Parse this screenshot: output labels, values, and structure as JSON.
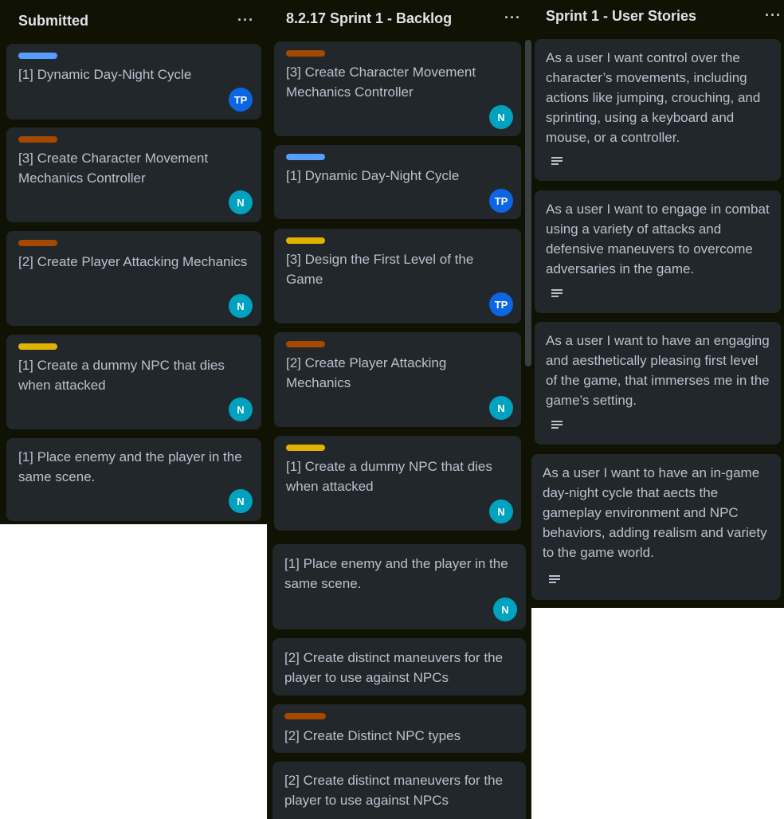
{
  "colors": {
    "board_bg": "#101204",
    "card_bg": "#22272b",
    "text": "#b6c2cf",
    "label_blue": "#579dff",
    "label_orange": "#a54800",
    "label_yellow": "#e2b203",
    "avatar_teal": "#00a3bf",
    "avatar_blue": "#0c66e4"
  },
  "lists": {
    "submitted": {
      "title": "Submitted",
      "menu": "···",
      "cards": [
        {
          "title": "[1] Dynamic Day-Night Cycle",
          "label": "blue",
          "avatar": "TP",
          "avatar_color": "blue"
        },
        {
          "title": "[3] Create Character Movement Mechanics Controller",
          "label": "orange",
          "avatar": "N",
          "avatar_color": "teal"
        },
        {
          "title": "[2] Create Player Attacking Mechanics",
          "label": "orange",
          "avatar": "N",
          "avatar_color": "teal"
        },
        {
          "title": "[1] Create a dummy NPC that dies when attacked",
          "label": "yellow",
          "avatar": "N",
          "avatar_color": "teal"
        },
        {
          "title": "[1] Place enemy and the player in the same scene.",
          "label": "none",
          "avatar": "N",
          "avatar_color": "teal"
        }
      ]
    },
    "backlog": {
      "title": "8.2.17 Sprint 1 - Backlog",
      "menu": "···",
      "cards": [
        {
          "title": "[3] Create Character Movement Mechanics Controller",
          "label": "orange",
          "avatar": "N",
          "avatar_color": "teal"
        },
        {
          "title": "[1] Dynamic Day-Night Cycle",
          "label": "blue",
          "avatar": "TP",
          "avatar_color": "blue"
        },
        {
          "title": "[3] Design the First Level of the Game",
          "label": "yellow",
          "avatar": "TP",
          "avatar_color": "blue"
        },
        {
          "title": "[2] Create Player Attacking Mechanics",
          "label": "orange",
          "avatar": "N",
          "avatar_color": "teal"
        },
        {
          "title": "[1] Create a dummy NPC that dies when attacked",
          "label": "yellow",
          "avatar": "N",
          "avatar_color": "teal"
        },
        {
          "title": "[1] Place enemy and the player in the same scene.",
          "label": "none",
          "avatar": "N",
          "avatar_color": "teal"
        },
        {
          "title": "[2] Create distinct maneuvers for the player to use against NPCs",
          "label": "none",
          "avatar": "",
          "avatar_color": ""
        },
        {
          "title": "[2] Create Distinct NPC types",
          "label": "orange",
          "avatar": "",
          "avatar_color": ""
        },
        {
          "title": "[2] Create distinct maneuvers for the player to use against NPCs",
          "label": "none",
          "avatar": "",
          "avatar_color": ""
        }
      ]
    },
    "stories": {
      "title": "Sprint 1 - User Stories",
      "menu": "···",
      "cards": [
        {
          "title": "As a user I want control over the character’s movements, including actions like jumping, crouching, and sprinting, using a keyboard and mouse, or a controller.",
          "icon": "description-icon"
        },
        {
          "title": "As a user I want to engage in combat using a variety of attacks and defensive maneuvers to overcome adversaries in the game.",
          "icon": "description-icon"
        },
        {
          "title": "As a user I want to have an engaging and aesthetically pleasing first level of the game, that immerses me in the game’s setting.",
          "icon": "description-icon"
        },
        {
          "title": "As a user I want to have an in-game day-night cycle that aects the gameplay environment and NPC behaviors, adding realism and variety to the game world.",
          "icon": "description-icon"
        }
      ]
    }
  }
}
